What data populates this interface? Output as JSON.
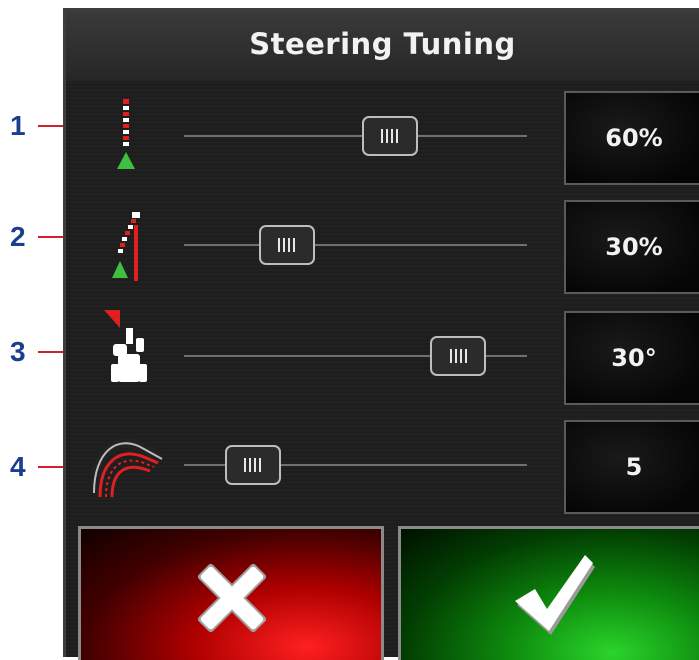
{
  "title": "Steering Tuning",
  "callouts": [
    "1",
    "2",
    "3",
    "4"
  ],
  "rows": [
    {
      "icon": "line-acquisition-aggressiveness-icon",
      "value": "60%",
      "slider_fraction": 0.6
    },
    {
      "icon": "online-aggressiveness-icon",
      "value": "30%",
      "slider_fraction": 0.3
    },
    {
      "icon": "steering-angle-icon",
      "value": "30°",
      "slider_fraction": 0.8
    },
    {
      "icon": "curve-response-icon",
      "value": "5",
      "slider_fraction": 0.2
    }
  ],
  "buttons": {
    "cancel": {
      "icon": "x-icon",
      "color": "#d01010"
    },
    "confirm": {
      "icon": "checkmark-icon",
      "color": "#16a016"
    }
  },
  "colors": {
    "callout_number": "#1b3e8f",
    "callout_line": "#d0202a"
  }
}
